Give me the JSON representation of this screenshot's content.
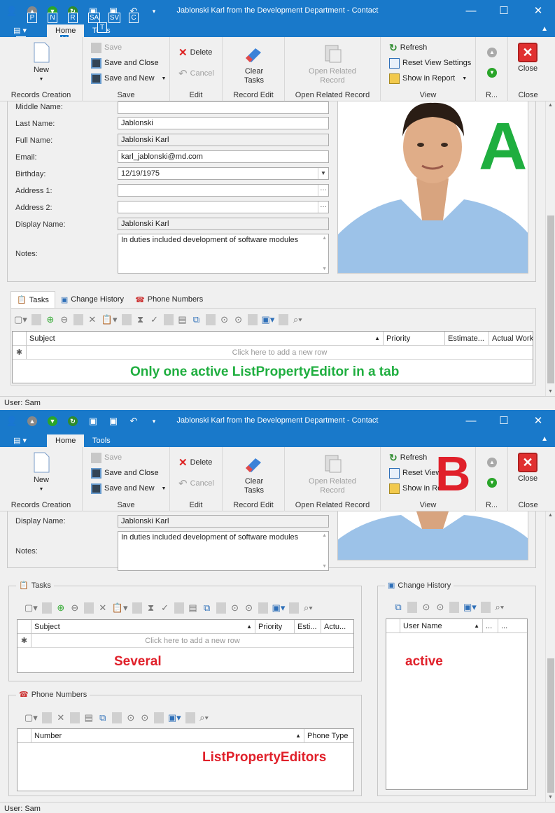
{
  "window_title": "Jablonski Karl from the Development Department - Contact",
  "menu_tabs": [
    "Home",
    "Tools"
  ],
  "keytips": [
    "P",
    "N",
    "R",
    "SA",
    "SV",
    "C",
    "A",
    "H",
    "T"
  ],
  "ribbon": {
    "new_label": "New",
    "records_creation": "Records Creation",
    "save": "Save",
    "save_and_close": "Save and Close",
    "save_and_new": "Save and New",
    "save_group": "Save",
    "delete": "Delete",
    "cancel": "Cancel",
    "edit_group": "Edit",
    "clear_tasks_1": "Clear",
    "clear_tasks_2": "Tasks",
    "record_edit_group": "Record Edit",
    "open_related_1": "Open Related",
    "open_related_2": "Record",
    "open_related_group": "Open Related Record",
    "refresh": "Refresh",
    "reset_view_settings": "Reset View Settings",
    "reset_view_short": "Reset View",
    "show_in_report": "Show in Report",
    "show_in_report_short": "Show in Re",
    "view_group": "View",
    "r_group": "R...",
    "close": "Close",
    "close_group": "Close"
  },
  "form": {
    "middle_name_label": "Middle Name:",
    "middle_name": "",
    "last_name_label": "Last Name:",
    "last_name": "Jablonski",
    "full_name_label": "Full Name:",
    "full_name": "Jablonski Karl",
    "email_label": "Email:",
    "email": "karl_jablonski@md.com",
    "birthday_label": "Birthday:",
    "birthday": "12/19/1975",
    "address1_label": "Address 1:",
    "address1": "",
    "address2_label": "Address 2:",
    "address2": "",
    "display_name_label": "Display Name:",
    "display_name": "Jablonski Karl",
    "notes_label": "Notes:",
    "notes": "In duties included  development of software modules"
  },
  "detail_tabs": [
    "Tasks",
    "Change History",
    "Phone Numbers"
  ],
  "tasks_grid": {
    "columns": [
      "Subject",
      "Priority",
      "Estimate...",
      "Actual Work"
    ],
    "columns_b": [
      "Subject",
      "Priority",
      "Esti...",
      "Actu..."
    ],
    "new_row": "Click here to add a new row"
  },
  "history_grid": {
    "columns": [
      "User Name",
      "...",
      "..."
    ]
  },
  "phones_grid": {
    "columns": [
      "Number",
      "Phone Type"
    ]
  },
  "status": "User: Sam",
  "annotations": {
    "letter_a": "A",
    "letter_b": "B",
    "caption_a": "Only one active ListPropertyEditor in a tab",
    "several": "Several",
    "active": "active",
    "list_editors": "ListPropertyEditors"
  },
  "colors": {
    "titlebar": "#1979ca",
    "annot_green": "#1fae3f",
    "annot_red": "#e0202a"
  }
}
